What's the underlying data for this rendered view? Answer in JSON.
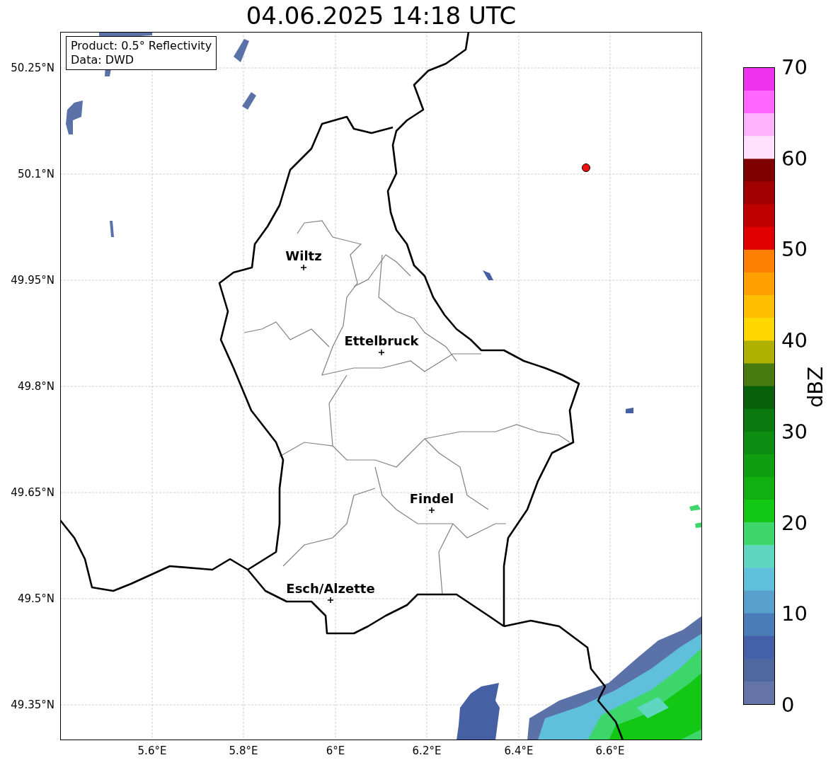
{
  "title": "04.06.2025 14:18 UTC",
  "info_box": {
    "lines": [
      "Product: 0.5° Reflectivity",
      "Data: DWD"
    ]
  },
  "map": {
    "y_ticks": [
      "50.25°N",
      "50.1°N",
      "49.95°N",
      "49.8°N",
      "49.65°N",
      "49.5°N",
      "49.35°N"
    ],
    "x_ticks": [
      "5.6°E",
      "5.8°E",
      "6°E",
      "6.2°E",
      "6.4°E",
      "6.6°E"
    ],
    "cities": [
      {
        "name": "Wiltz"
      },
      {
        "name": "Ettelbruck"
      },
      {
        "name": "Findel"
      },
      {
        "name": "Esch/Alzette"
      }
    ]
  },
  "colorbar": {
    "label": "dBZ",
    "ticks": [
      "70",
      "60",
      "50",
      "40",
      "30",
      "20",
      "10",
      "0"
    ],
    "bands": [
      {
        "color": "#ee33ee"
      },
      {
        "color": "#ff66ff"
      },
      {
        "color": "#ffb3ff"
      },
      {
        "color": "#ffe0ff"
      },
      {
        "color": "#7f0000"
      },
      {
        "color": "#a00000"
      },
      {
        "color": "#c00000"
      },
      {
        "color": "#e00000"
      },
      {
        "color": "#ff7f00"
      },
      {
        "color": "#ff9f00"
      },
      {
        "color": "#ffbf00"
      },
      {
        "color": "#ffd700"
      },
      {
        "color": "#b0b000"
      },
      {
        "color": "#487a10"
      },
      {
        "color": "#086008"
      },
      {
        "color": "#0a7a10"
      },
      {
        "color": "#0c8c10"
      },
      {
        "color": "#0e9e10"
      },
      {
        "color": "#10b010"
      },
      {
        "color": "#12c814"
      },
      {
        "color": "#3cd66a"
      },
      {
        "color": "#5ed6c0"
      },
      {
        "color": "#60c0dc"
      },
      {
        "color": "#5aa0cc"
      },
      {
        "color": "#4a7cb8"
      },
      {
        "color": "#4460a8"
      },
      {
        "color": "#5068a0"
      },
      {
        "color": "#6474a8"
      }
    ]
  }
}
